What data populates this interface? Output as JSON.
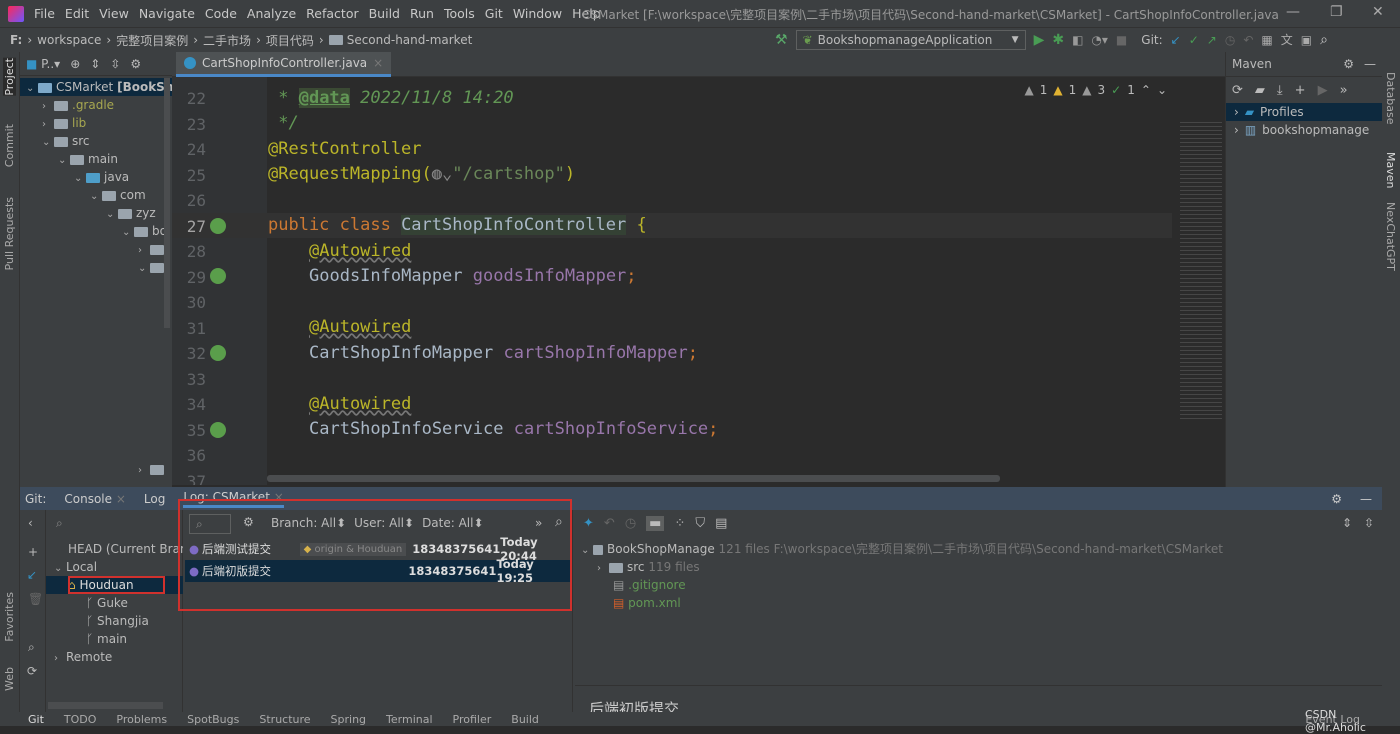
{
  "menubar": {
    "items": [
      "File",
      "Edit",
      "View",
      "Navigate",
      "Code",
      "Analyze",
      "Refactor",
      "Build",
      "Run",
      "Tools",
      "Git",
      "Window",
      "Help"
    ],
    "title": "CSMarket [F:\\workspace\\完整项目案例\\二手市场\\项目代码\\Second-hand-market\\CSMarket] - CartShopInfoController.java"
  },
  "breadcrumb": [
    "F:",
    "workspace",
    "完整项目案例",
    "二手市场",
    "项目代码",
    "Second-hand-market"
  ],
  "toolbar": {
    "run_config": "BookshopmanageApplication",
    "git_label": "Git:"
  },
  "left_strip": [
    "Project",
    "Commit",
    "Pull Requests",
    "Favorites",
    "Web"
  ],
  "project": {
    "view_label": "P..",
    "root": "CSMarket",
    "root_module": "[BookShop",
    "items": [
      ".gradle",
      "lib",
      "src",
      "main",
      "java",
      "com",
      "zyz",
      "bo"
    ]
  },
  "editor": {
    "tab": "CartShopInfoController.java",
    "inspections": {
      "weak_warnings": "1",
      "warnings": "1",
      "typos": "3",
      "ok": "1"
    },
    "line_numbers": [
      "22",
      "23",
      "24",
      "25",
      "26",
      "27",
      "28",
      "29",
      "30",
      "31",
      "32",
      "33",
      "34",
      "35",
      "36",
      "37"
    ],
    "code": {
      "l22_star": " * ",
      "l22_tag": "@data",
      "l22_date": " 2022/11/8 14:20",
      "l23": " */",
      "l24": "@RestController",
      "l25_a": "@RequestMapping(",
      "l25_s": "\"/cartshop\"",
      "l25_b": ")",
      "l27_kw": "public class ",
      "l27_name": "CartShopInfoController",
      "l27_brace": " {",
      "ann": "@Autowired",
      "l29_t": "GoodsInfoMapper ",
      "l29_f": "goodsInfoMapper",
      "l32_t": "CartShopInfoMapper ",
      "l32_f": "cartShopInfoMapper",
      "l35_t": "CartShopInfoService ",
      "l35_f": "cartShopInfoService",
      "semi": ";"
    }
  },
  "maven": {
    "title": "Maven",
    "items": [
      "Profiles",
      "bookshopmanage"
    ]
  },
  "right_strip": [
    "Database",
    "Maven",
    "NexChatGPT"
  ],
  "git": {
    "tabs": [
      "Git:",
      "Console",
      "Log",
      "Log: CSMarket"
    ],
    "branches": {
      "head": "HEAD (Current Branch)",
      "local": "Local",
      "local_branches": [
        "Houduan",
        "Guke",
        "Shangjia",
        "main"
      ],
      "remote": "Remote"
    },
    "filters": {
      "branch": "Branch: All",
      "user": "User: All",
      "date": "Date: All"
    },
    "commits": [
      {
        "message": "后端测试提交",
        "refs": "origin & Houduan",
        "author": "18348375641",
        "date": "Today 20:44"
      },
      {
        "message": "后端初版提交",
        "refs": "",
        "author": "18348375641",
        "date": "Today 19:25"
      }
    ],
    "details": {
      "module": "BookShopManage",
      "module_count": "121 files",
      "module_path": "F:\\workspace\\完整项目案例\\二手市场\\项目代码\\Second-hand-market\\CSMarket",
      "src": "src",
      "src_count": "119 files",
      "files": [
        ".gitignore",
        "pom.xml"
      ],
      "commit_message": "后端初版提交"
    }
  },
  "statusbar": [
    "Git",
    "TODO",
    "Problems",
    "SpotBugs",
    "Structure",
    "Spring",
    "Terminal",
    "Profiler",
    "Build"
  ],
  "event_log": "Event Log",
  "watermark": "CSDN @Mr.Aholic"
}
